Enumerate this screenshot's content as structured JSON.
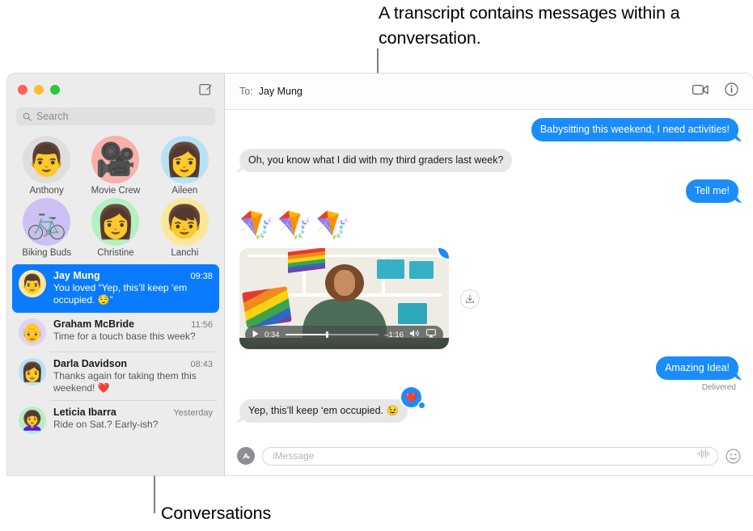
{
  "annotations": {
    "top": "A transcript contains messages within a conversation.",
    "bottom": "Conversations"
  },
  "window": {
    "traffic_lights": {
      "close": "close-button",
      "minimize": "minimize-button",
      "maximize": "maximize-button"
    },
    "compose_label": "New Message"
  },
  "sidebar": {
    "search": {
      "placeholder": "Search",
      "icon": "search-icon"
    },
    "pinned": [
      {
        "name": "Anthony",
        "emoji": "👨",
        "color": "#dedede"
      },
      {
        "name": "Movie Crew",
        "emoji": "🎥",
        "color": "#f8b0ab"
      },
      {
        "name": "Aileen",
        "emoji": "👩",
        "color": "#b6e2f5"
      },
      {
        "name": "Biking Buds",
        "emoji": "🚲",
        "color": "#ccc0f5"
      },
      {
        "name": "Christine",
        "emoji": "👩",
        "color": "#b4f0c2"
      },
      {
        "name": "Lanchi",
        "emoji": "👦",
        "color": "#fbe79a"
      }
    ],
    "conversations": [
      {
        "name": "Jay Mung",
        "time": "09:38",
        "preview": "You loved “Yep, this’ll keep ‘em occupied. 😌”",
        "avatar_emoji": "👨",
        "avatar_color": "#fbe79a",
        "selected": true
      },
      {
        "name": "Graham McBride",
        "time": "11:56",
        "preview": "Time for a touch base this week?",
        "avatar_emoji": "👴",
        "avatar_color": "#ddd3f7",
        "selected": false
      },
      {
        "name": "Darla Davidson",
        "time": "08:43",
        "preview": "Thanks again for taking them this weekend! ❤️",
        "avatar_emoji": "👩",
        "avatar_color": "#b6e2f5",
        "selected": false
      },
      {
        "name": "Leticia Ibarra",
        "time": "Yesterday",
        "preview": "Ride on Sat.? Early-ish?",
        "avatar_emoji": "👩‍🦱",
        "avatar_color": "#b4f0c2",
        "selected": false
      }
    ]
  },
  "transcript": {
    "to_label": "To:",
    "recipient": "Jay Mung",
    "facetime_icon": "video-camera-icon",
    "info_icon": "info-circle-icon",
    "messages": [
      {
        "type": "text",
        "direction": "out",
        "text": "Babysitting this weekend, I need activities!"
      },
      {
        "type": "text",
        "direction": "in",
        "text": "Oh, you know what I did with my third graders last week?"
      },
      {
        "type": "text",
        "direction": "out",
        "text": "Tell me!"
      },
      {
        "type": "emoji",
        "direction": "in",
        "text": "🪁🪁🪁"
      },
      {
        "type": "video",
        "direction": "in",
        "tapback": "❤️"
      },
      {
        "type": "text",
        "direction": "out",
        "text": "Amazing Idea!",
        "status": "Delivered"
      },
      {
        "type": "text",
        "direction": "in",
        "text": "Yep, this’ll keep ‘em occupied. 😉",
        "tapback": "❤️"
      }
    ],
    "video": {
      "elapsed": "0:34",
      "remaining": "–1:16",
      "play_icon": "play-icon",
      "volume_icon": "volume-icon",
      "airplay_icon": "airplay-icon",
      "download_icon": "download-icon"
    }
  },
  "composer": {
    "apps_icon": "app-store-icon",
    "placeholder": "iMessage",
    "audio_icon": "audio-waveform-icon",
    "emoji_icon": "emoji-smiley-icon"
  },
  "colors": {
    "accent_blue": "#1b8cfb",
    "selected_row": "#0a7bff",
    "received_bubble": "#e7e7e9",
    "sidebar_bg": "#ececec"
  }
}
